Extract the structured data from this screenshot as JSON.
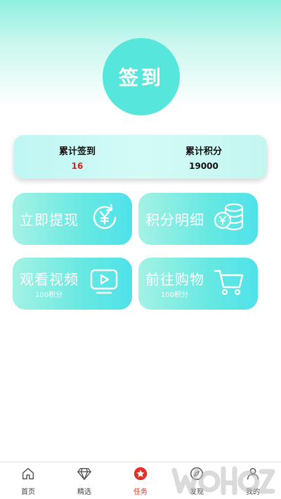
{
  "signin": {
    "label": "签到"
  },
  "stats": {
    "days_label": "累计签到",
    "days_value": "16",
    "points_label": "累计积分",
    "points_value": "19000"
  },
  "tiles": [
    {
      "title": "立即提现",
      "subtitle": "",
      "icon": "yuan-refresh-icon"
    },
    {
      "title": "积分明细",
      "subtitle": "",
      "icon": "coin-stack-icon"
    },
    {
      "title": "观看视频",
      "subtitle": "100积分",
      "icon": "video-play-icon"
    },
    {
      "title": "前往购物",
      "subtitle": "100积分",
      "icon": "shopping-cart-icon"
    }
  ],
  "nav": [
    {
      "label": "首页",
      "icon": "home-icon",
      "active": false
    },
    {
      "label": "精选",
      "icon": "diamond-icon",
      "active": false
    },
    {
      "label": "任务",
      "icon": "star-badge-icon",
      "active": true
    },
    {
      "label": "发现",
      "icon": "compass-icon",
      "active": false
    },
    {
      "label": "我的",
      "icon": "user-icon",
      "active": false
    }
  ],
  "colors": {
    "accent": "#57e6dc",
    "highlight_red": "#e02020",
    "active_nav": "#e0302a"
  }
}
